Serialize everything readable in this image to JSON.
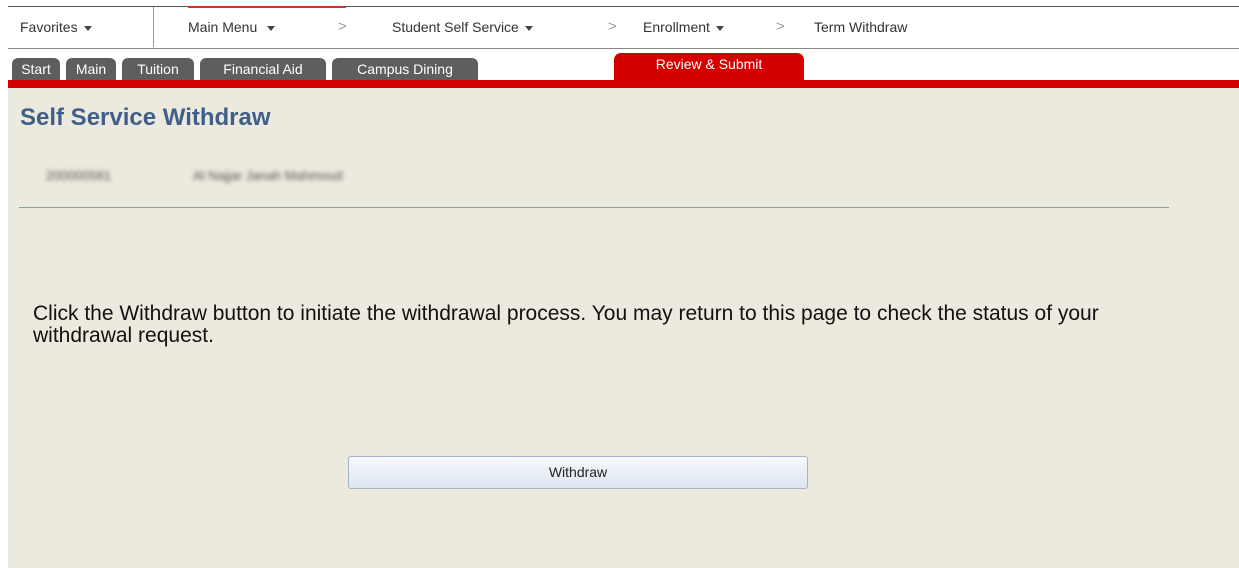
{
  "topbar": {
    "favorites_label": "Favorites",
    "breadcrumbs": [
      {
        "label": "Main Menu",
        "has_caret": true
      },
      {
        "label": "Student Self Service",
        "has_caret": true
      },
      {
        "label": "Enrollment",
        "has_caret": true
      },
      {
        "label": "Term Withdraw",
        "has_caret": false
      }
    ],
    "separator": ">"
  },
  "tabs": [
    {
      "label": "Start",
      "active": false
    },
    {
      "label": "Main",
      "active": false
    },
    {
      "label": "Tuition",
      "active": false
    },
    {
      "label": "Financial Aid",
      "active": false
    },
    {
      "label": "Campus Dining",
      "active": false
    },
    {
      "label": "Review & Submit",
      "active": true
    }
  ],
  "main": {
    "title": "Self Service Withdraw",
    "student_id": "200000581",
    "student_name": "Al Najjar Janah Mahmoud",
    "instructions": "Click the Withdraw button to initiate the withdrawal process. You may return to this page to check the status of your withdrawal request.",
    "withdraw_button_label": "Withdraw"
  },
  "colors": {
    "content_background": "#ece9de",
    "title_color": "#3f5f8a",
    "tab_inactive": "#5e5e5e",
    "tab_active": "#d40000"
  }
}
